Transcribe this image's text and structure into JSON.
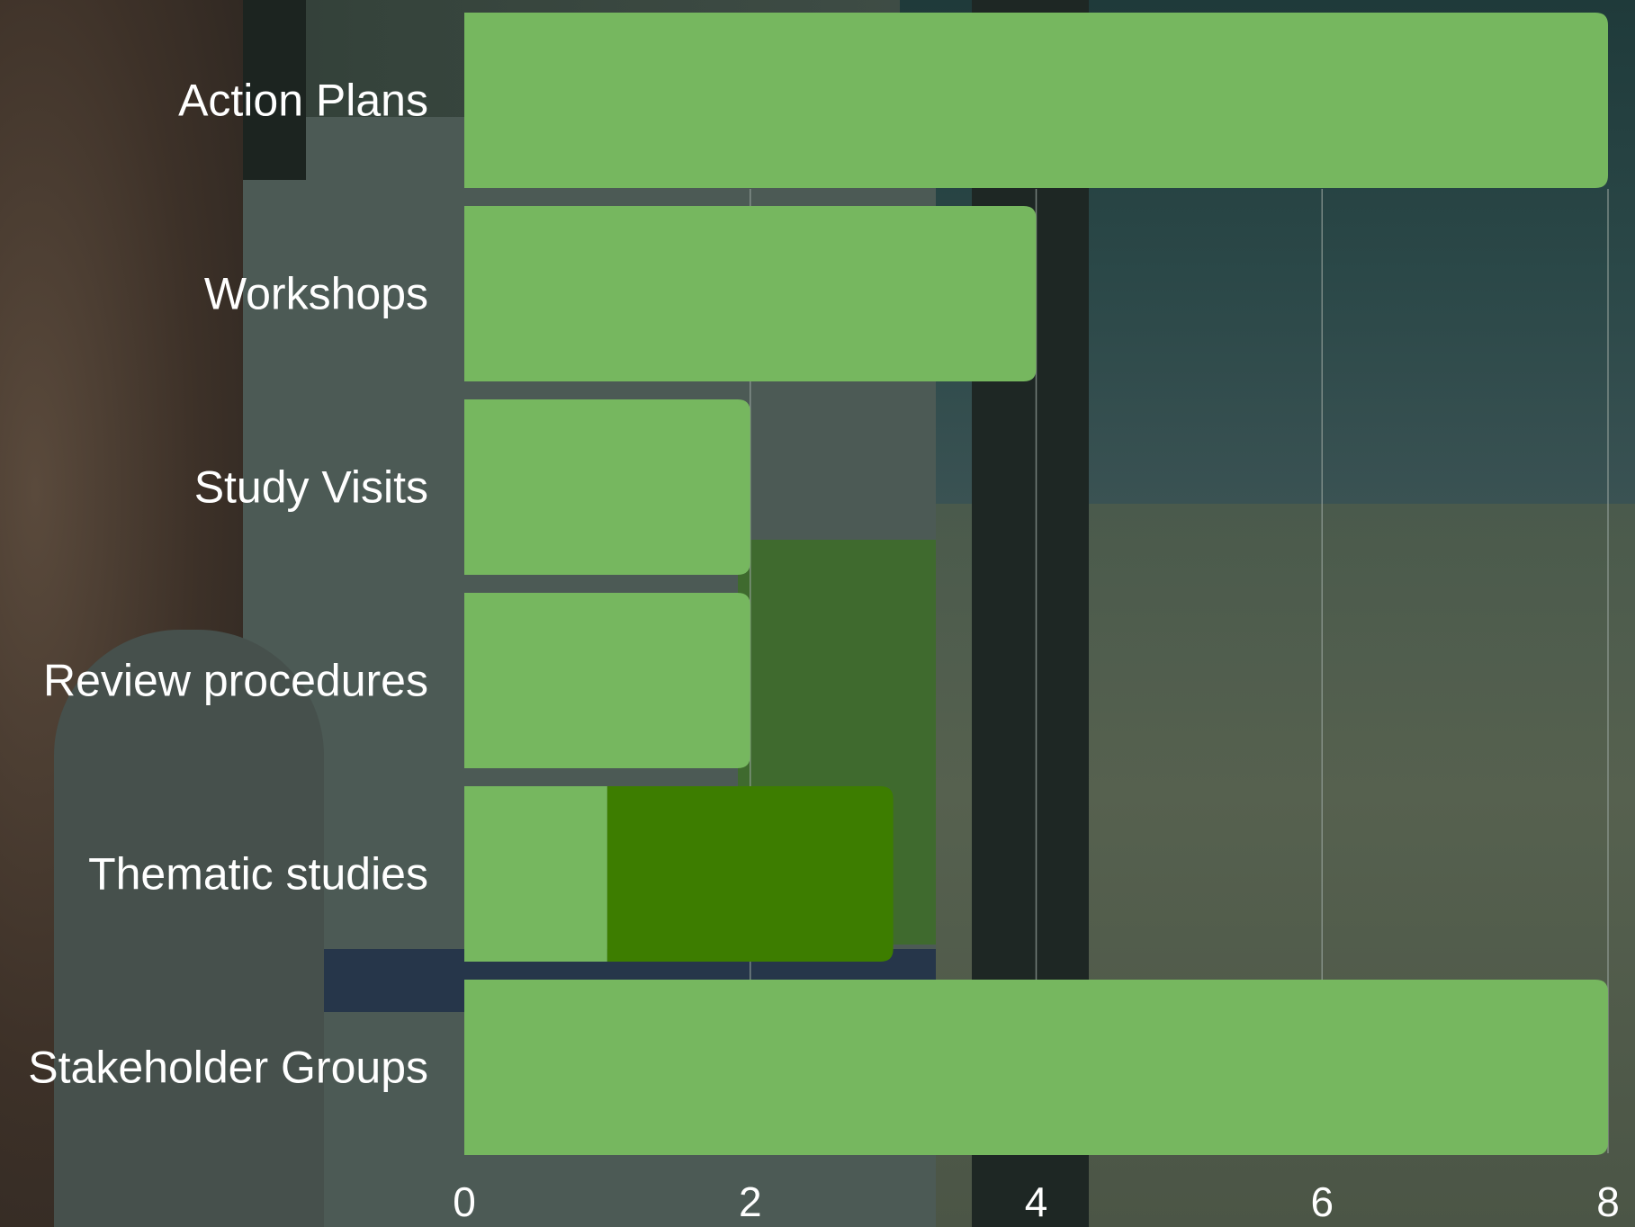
{
  "chart_data": {
    "type": "bar",
    "orientation": "horizontal",
    "stacked": true,
    "categories": [
      "Action Plans",
      "Workshops",
      "Study Visits",
      "Review procedures",
      "Thematic studies",
      "Stakeholder Groups"
    ],
    "series": [
      {
        "color": "#76b75f",
        "values": [
          8,
          4,
          2,
          2,
          1,
          8
        ]
      },
      {
        "color": "#3d7d00",
        "values": [
          0,
          0,
          0,
          0,
          2,
          0
        ]
      }
    ],
    "xlim": [
      0,
      8
    ],
    "xticks": [
      "0",
      "2",
      "4",
      "6",
      "8"
    ],
    "title": "",
    "xlabel": "",
    "ylabel": "",
    "grid": "vertical",
    "legend": "none"
  },
  "colors": {
    "label_text": "#ffffff",
    "gridline": "#9aa59f"
  }
}
